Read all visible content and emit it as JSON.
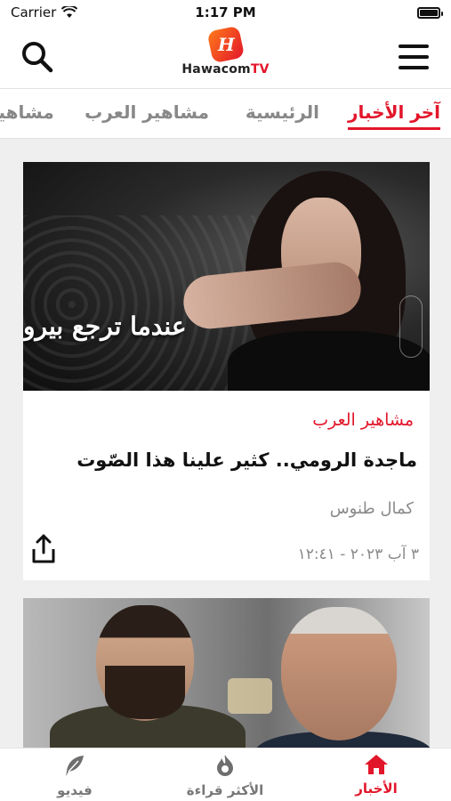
{
  "status_bar": {
    "carrier": "Carrier",
    "time": "1:17 PM"
  },
  "header": {
    "logo_letter": "H",
    "logo_name": "Hawacom",
    "logo_suffix": "TV"
  },
  "tabs": [
    {
      "label": "آخر الأخبار",
      "active": true
    },
    {
      "label": "الرئيسية",
      "active": false
    },
    {
      "label": "مشاهير العرب",
      "active": false
    },
    {
      "label": "مشاهير",
      "active": false
    }
  ],
  "articles": [
    {
      "image_caption": "عندما ترجع بيرو",
      "category": "مشاهير العرب",
      "title": "ماجدة الرومي.. كثير علينا هذا الصّوت",
      "author": "كمال طنوس",
      "date": "٣ آب ٢٠٢٣ - ١٢:٤١"
    }
  ],
  "bottom_nav": [
    {
      "label": "الأخبار",
      "icon": "home-icon",
      "active": true
    },
    {
      "label": "الأكثر قراءة",
      "icon": "flame-icon",
      "active": false
    },
    {
      "label": "فيديو",
      "icon": "feather-icon",
      "active": false
    }
  ],
  "colors": {
    "accent": "#e2162a",
    "inactive": "#888888"
  }
}
